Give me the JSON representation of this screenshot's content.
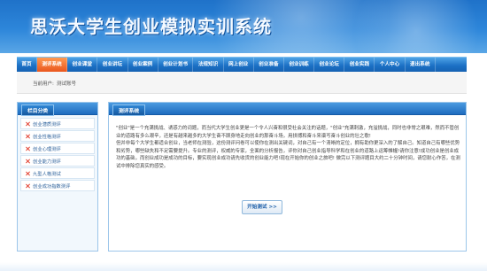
{
  "header": {
    "title": "思沃大学生创业模拟实训系统"
  },
  "nav": {
    "items": [
      {
        "label": "首页",
        "active": false
      },
      {
        "label": "测评系统",
        "active": true
      },
      {
        "label": "创业课堂",
        "active": false
      },
      {
        "label": "创业讲坛",
        "active": false
      },
      {
        "label": "创业案例",
        "active": false
      },
      {
        "label": "创业计划书",
        "active": false
      },
      {
        "label": "法规知识",
        "active": false
      },
      {
        "label": "网上创业",
        "active": false
      },
      {
        "label": "创业准备",
        "active": false
      },
      {
        "label": "创业训练",
        "active": false
      },
      {
        "label": "创业论坛",
        "active": false
      },
      {
        "label": "创业实践",
        "active": false
      },
      {
        "label": "个人中心",
        "active": false
      },
      {
        "label": "退出系统",
        "active": false
      }
    ]
  },
  "userbar": {
    "label": "当前用户:",
    "value": "测试账号"
  },
  "sidebar": {
    "title": "栏目分类",
    "items": [
      "创业潜质测评",
      "创业性格测评",
      "创业心理测评",
      "创业能力测评",
      "九型人格测试",
      "创业成功指数测评"
    ]
  },
  "main": {
    "title": "测评系统",
    "paragraphs": [
      "\"创业\"是一个充满挑战、诱惑力的词题，而当代大学生创业更是一个令人兴奋和很受社会关注的话题，\"创业\"充满刺激，充溢挑战，同时也非常之艰难，然而不管创业的道路有多么艰辛，还是有越来越多的大学生奋不顾身地走向创业的那奋斗场，用拼搏和奋斗来谱写奋斗创业的壮之歌!",
      "但并非每个大学生都适合创业，当老师在测验，这份测评问卷可以使你在测出关键词，对自己有一个清晰的定位，拥有助你更深入的了解自己。知道自己有哪些优势和劣势，哪些缺失和不足需要提升。专业的测评，权威的专家，全面的分析报告，评你对自己创业指导科学和在创业的道路上运筹帷幄!请你注意!成功创业是创业成功的基础，而创业成功是成功的目标，要实现创业成功请先收货的创业能力吧!现在开始你的创业之旅吧!     做完以下测评题目大约二十分钟时间，请您耐心作答，在测试中排除您真实的感受。"
    ],
    "button_label": "开始测试 >>"
  }
}
